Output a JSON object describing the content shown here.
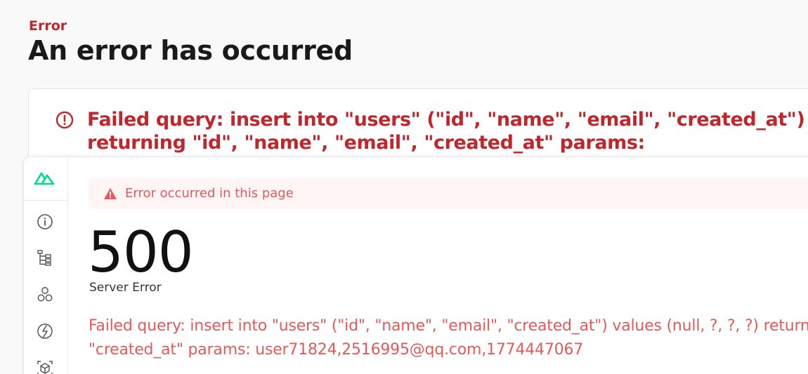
{
  "header": {
    "error_label": "Error",
    "title": "An error has occurred"
  },
  "error_card": {
    "query_line1": "Failed query: insert into \"users\" (\"id\", \"name\", \"email\", \"created_at\") values",
    "query_line2": "returning \"id\", \"name\", \"email\", \"created_at\" params:"
  },
  "devtools": {
    "sidebar": {
      "logo": "nuxt-logo-icon",
      "items": [
        {
          "icon": "info-icon"
        },
        {
          "icon": "component-tree-icon"
        },
        {
          "icon": "components-icon"
        },
        {
          "icon": "hooks-icon"
        },
        {
          "icon": "cube-icon"
        }
      ]
    },
    "banner": {
      "text": "Error occurred in this page",
      "icon": "warning-icon"
    },
    "status_code": "500",
    "status_text": "Server Error",
    "message_line1": "Failed query: insert into \"users\" (\"id\", \"name\", \"email\", \"created_at\") values (null, ?, ?, ?) returning \"id\", \"name\", \"email\",",
    "message_line2": "\"created_at\" params: user71824,2516995@qq.com,1774447067"
  },
  "colors": {
    "error_red": "#c0272d",
    "message_red": "#e45959",
    "nuxt_green": "#00dc82",
    "banner_bg": "#fff5f5"
  }
}
